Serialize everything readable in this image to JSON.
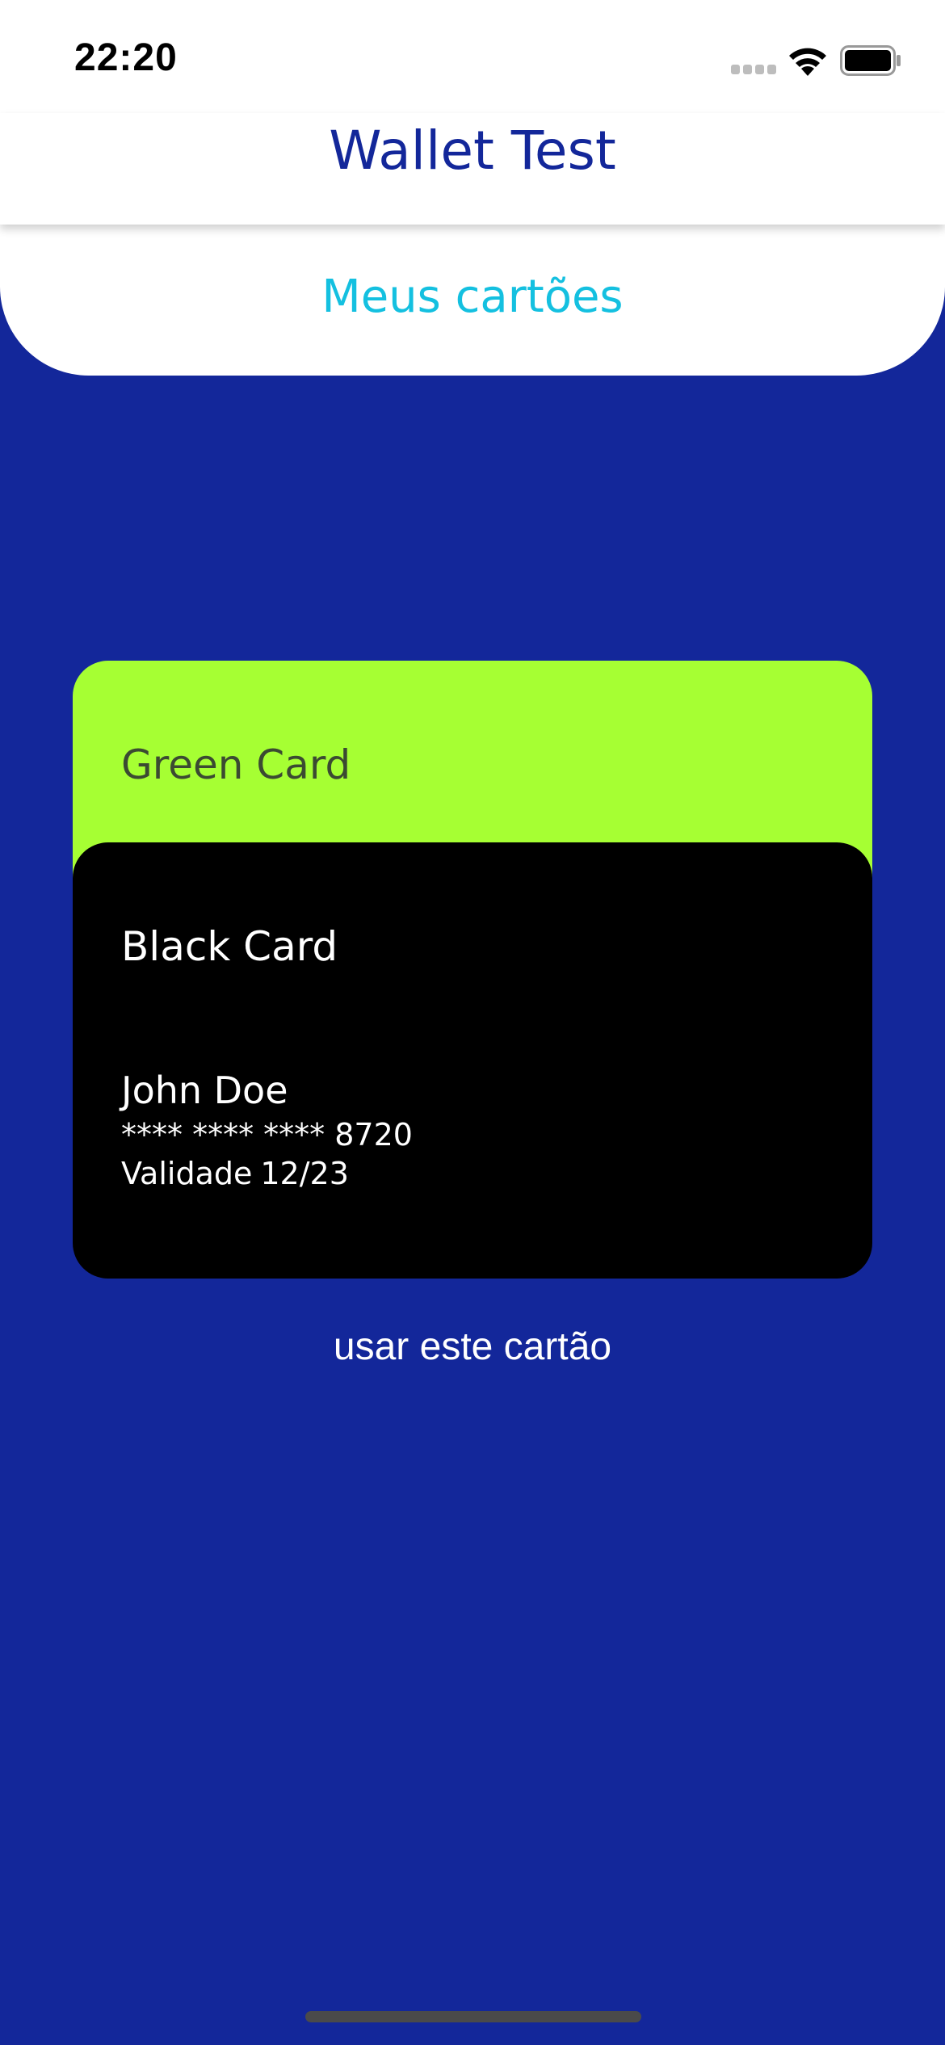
{
  "status_bar": {
    "time": "22:20",
    "signal_icon": "cellular-signal-icon",
    "wifi_icon": "wifi-icon",
    "battery_icon": "battery-icon"
  },
  "nav": {
    "title": "Wallet Test"
  },
  "section": {
    "title": "Meus cartões"
  },
  "cards": [
    {
      "name": "Green Card",
      "color": "#a6ff33"
    },
    {
      "name": "Black Card",
      "color": "#000000",
      "holder": "John Doe",
      "number": "**** **** **** 8720",
      "validity_label": "Validade",
      "validity_value": "12/23"
    }
  ],
  "actions": {
    "use_card_label": "usar este cartão"
  },
  "colors": {
    "background": "#13279a",
    "accent_title": "#13279a",
    "section_title": "#14c0e0"
  }
}
